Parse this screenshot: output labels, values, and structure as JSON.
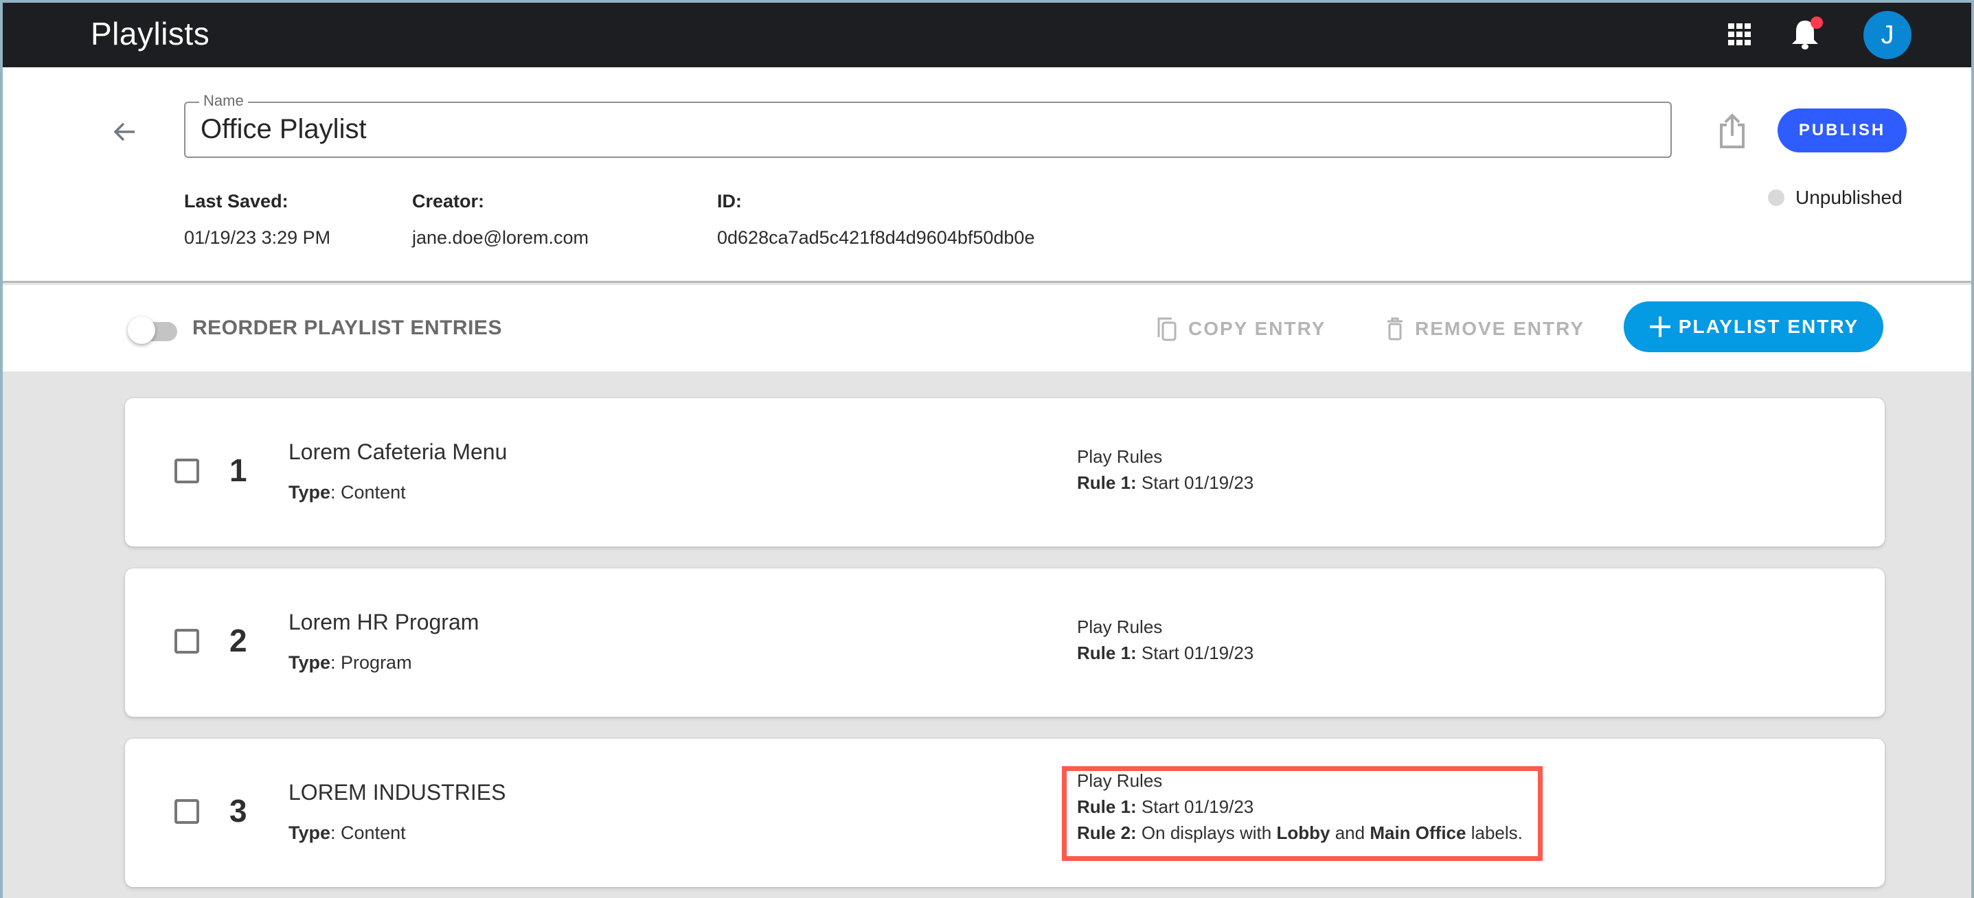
{
  "app": {
    "title": "Playlists",
    "avatar_initial": "J",
    "icons": {
      "apps": "apps-grid-icon",
      "notifications": "bell-icon",
      "notification_badge": "red-dot"
    },
    "colors": {
      "topbar": "#1d1e21",
      "avatar": "#0a87d2",
      "badge": "#ff3b4e"
    }
  },
  "header": {
    "name_label": "Name",
    "name_value": "Office Playlist",
    "publish_label": "PUBLISH",
    "publish_color": "#2f5cff",
    "status": "Unpublished",
    "meta": {
      "last_saved_label": "Last Saved:",
      "last_saved_value": "01/19/23 3:29 PM",
      "creator_label": "Creator:",
      "creator_value": "jane.doe@lorem.com",
      "id_label": "ID:",
      "id_value": "0d628ca7ad5c421f8d4d9604bf50db0e"
    }
  },
  "toolbar": {
    "reorder_label": "REORDER PLAYLIST ENTRIES",
    "reorder_enabled": false,
    "copy_label": "COPY ENTRY",
    "remove_label": "REMOVE ENTRY",
    "add_label": "PLAYLIST ENTRY",
    "add_color": "#049ae4"
  },
  "entries": [
    {
      "number": "1",
      "title": "Lorem Cafeteria Menu",
      "type_label": "Type",
      "type_value": "Content",
      "rules_title": "Play Rules",
      "rules": [
        {
          "label": "Rule 1:",
          "text": "Start 01/19/23"
        }
      ]
    },
    {
      "number": "2",
      "title": "Lorem HR Program",
      "type_label": "Type",
      "type_value": "Program",
      "rules_title": "Play Rules",
      "rules": [
        {
          "label": "Rule 1:",
          "text": "Start 01/19/23"
        }
      ]
    },
    {
      "number": "3",
      "title": "LOREM INDUSTRIES",
      "type_label": "Type",
      "type_value": "Content",
      "rules_title": "Play Rules",
      "rules": [
        {
          "label": "Rule 1:",
          "text": "Start 01/19/23"
        },
        {
          "label": "Rule 2:",
          "text_prefix": "On displays with",
          "tag1": "Lobby",
          "joiner": "and",
          "tag2": "Main Office",
          "text_suffix": "labels."
        }
      ],
      "highlighted": true,
      "highlight_color": "#ff5a4d"
    }
  ]
}
